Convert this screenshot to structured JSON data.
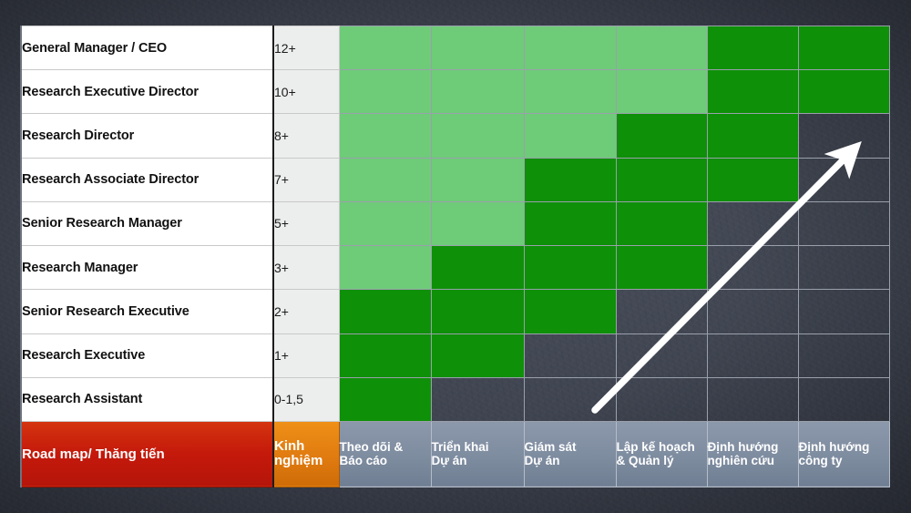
{
  "slide": {
    "title_row_label": "Road map/ Thăng tiến",
    "experience_header": "Kinh\nnghiệm",
    "background_color": "#3c414d",
    "arrow_color": "#ffffff",
    "arrow_name": "growth-arrow"
  },
  "legend_colors": {
    "light_green": "#6ecb78",
    "dark_green": "#0e9008",
    "empty": "#3c414d",
    "red_header": "#c4190b",
    "orange_header": "#e07b10",
    "column_header": "#7e8ca0"
  },
  "columns": [
    "Theo dõi &\nBáo cáo",
    "Triển khai\nDự án",
    "Giám sát\nDự án",
    "Lập kế hoạch\n& Quản lý",
    "Định hướng\nnghiên cứu",
    "Định hướng\ncông ty"
  ],
  "rows": [
    {
      "role": "General Manager / CEO",
      "experience": "12+",
      "levels": [
        "l",
        "l",
        "l",
        "l",
        "d",
        "d"
      ]
    },
    {
      "role": "Research Executive Director",
      "experience": "10+",
      "levels": [
        "l",
        "l",
        "l",
        "l",
        "d",
        "d"
      ]
    },
    {
      "role": "Research Director",
      "experience": "8+",
      "levels": [
        "l",
        "l",
        "l",
        "d",
        "d",
        "e"
      ]
    },
    {
      "role": "Research Associate Director",
      "experience": "7+",
      "levels": [
        "l",
        "l",
        "d",
        "d",
        "d",
        "e"
      ]
    },
    {
      "role": "Senior Research Manager",
      "experience": "5+",
      "levels": [
        "l",
        "l",
        "d",
        "d",
        "e",
        "e"
      ]
    },
    {
      "role": "Research Manager",
      "experience": "3+",
      "levels": [
        "l",
        "d",
        "d",
        "d",
        "e",
        "e"
      ]
    },
    {
      "role": "Senior Research Executive",
      "experience": "2+",
      "levels": [
        "d",
        "d",
        "d",
        "e",
        "e",
        "e"
      ]
    },
    {
      "role": "Research Executive",
      "experience": "1+",
      "levels": [
        "d",
        "d",
        "e",
        "e",
        "e",
        "e"
      ]
    },
    {
      "role": "Research Assistant",
      "experience": "0-1,5",
      "levels": [
        "d",
        "e",
        "e",
        "e",
        "e",
        "e"
      ]
    }
  ]
}
